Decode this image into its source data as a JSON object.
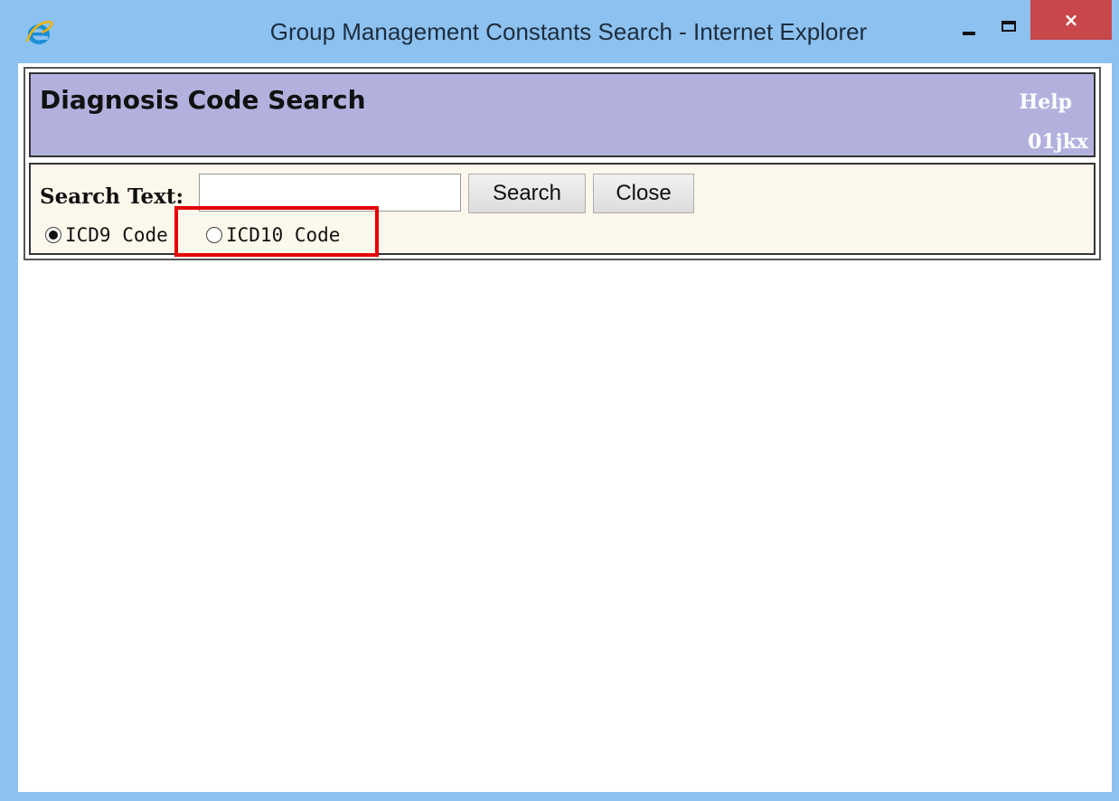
{
  "window": {
    "title": "Group Management Constants Search - Internet Explorer",
    "controls": {
      "minimize": "minimize-icon",
      "maximize": "maximize-icon",
      "close_glyph": "×"
    },
    "close_color": "#c8474b",
    "frame_color": "#8cc1f0"
  },
  "header": {
    "title": "Diagnosis Code Search",
    "help_link": "Help",
    "user_id": "01jkx",
    "background": "#b2b1de"
  },
  "search": {
    "label": "Search Text:",
    "input_value": "",
    "search_button": "Search",
    "close_button": "Close",
    "background": "#fdf8ec"
  },
  "code_type": {
    "options": [
      {
        "label": "ICD9 Code",
        "selected": true
      },
      {
        "label": "ICD10 Code",
        "selected": false
      }
    ]
  },
  "annotation": {
    "highlight_color": "#e60000"
  }
}
